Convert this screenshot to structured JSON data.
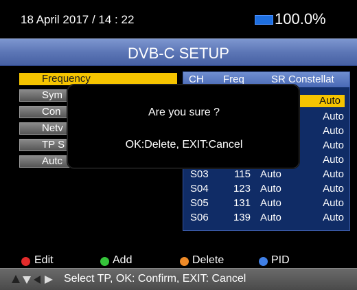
{
  "status": {
    "datetime": "18 April 2017 / 14 : 22",
    "battery": "100.0%"
  },
  "title": "DVB-C SETUP",
  "menu": [
    {
      "label": "Frequency",
      "active": true
    },
    {
      "label": "Sym"
    },
    {
      "label": "Con"
    },
    {
      "label": "Netv"
    },
    {
      "label": "TP S"
    },
    {
      "label": "Autc"
    }
  ],
  "table": {
    "headers": {
      "ch": "CH",
      "freq": "Freq",
      "sr": "SR",
      "con": "Constellat"
    },
    "visible_constellation_top": [
      "Auto",
      "Auto",
      "Auto",
      "Auto",
      "Auto"
    ],
    "rows": [
      {
        "ch": "S03",
        "freq": "115",
        "sr": "Auto",
        "con": "Auto"
      },
      {
        "ch": "S04",
        "freq": "123",
        "sr": "Auto",
        "con": "Auto"
      },
      {
        "ch": "S05",
        "freq": "131",
        "sr": "Auto",
        "con": "Auto"
      },
      {
        "ch": "S06",
        "freq": "139",
        "sr": "Auto",
        "con": "Auto"
      }
    ]
  },
  "dialog": {
    "question": "Are you sure ?",
    "options": "OK:Delete, EXIT:Cancel"
  },
  "legend": [
    {
      "label": "Edit",
      "color": "#e32b2b"
    },
    {
      "label": "Add",
      "color": "#35c43a"
    },
    {
      "label": "Delete",
      "color": "#ee8a27"
    },
    {
      "label": "PID",
      "color": "#3f7fe6"
    }
  ],
  "hint": "Select TP, OK: Confirm, EXIT: Cancel",
  "colors": {
    "accent": "#f5c400",
    "title_bar": "#5c76b6",
    "table_bg": "#102c66"
  }
}
